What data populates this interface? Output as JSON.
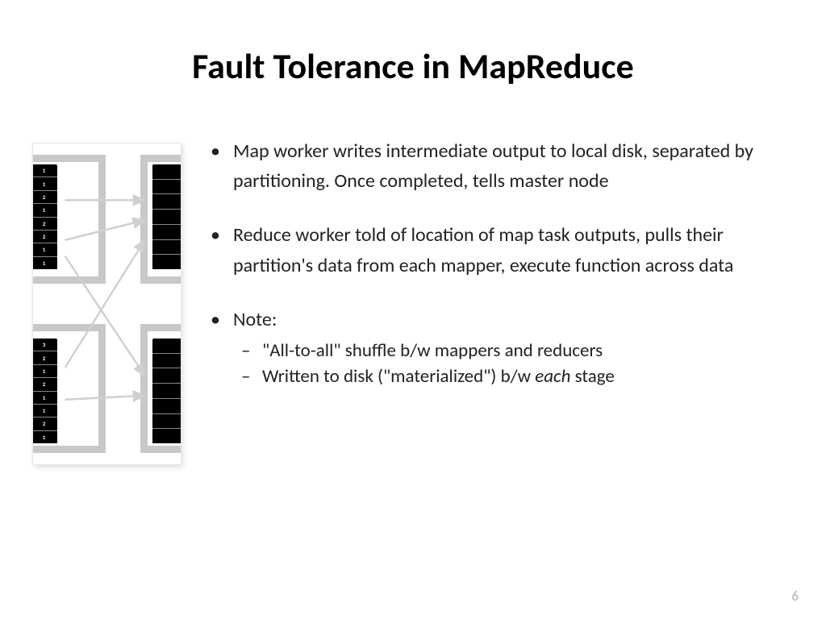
{
  "title": "Fault Tolerance in MapReduce",
  "bullets": [
    "Map worker writes intermediate output to local disk, separated by partitioning. Once completed, tells master node",
    "Reduce worker told of location of map task outputs, pulls their partition's data from each mapper, execute function across data",
    "Note:"
  ],
  "sub_bullets": [
    "\"All-to-all\" shuffle b/w mappers and reducers",
    "Written to disk (\"materialized\") b/w "
  ],
  "sub_bullet_2_suffix_italic": "each",
  "sub_bullet_2_suffix_plain": " stage",
  "page_number": "6",
  "diagram": {
    "top_left_block": [
      "1",
      "1",
      "2",
      "1",
      "2",
      "2",
      "1",
      "1"
    ],
    "bottom_left_block": [
      "3",
      "2",
      "1",
      "2",
      "1",
      "1",
      "2",
      "1"
    ]
  }
}
